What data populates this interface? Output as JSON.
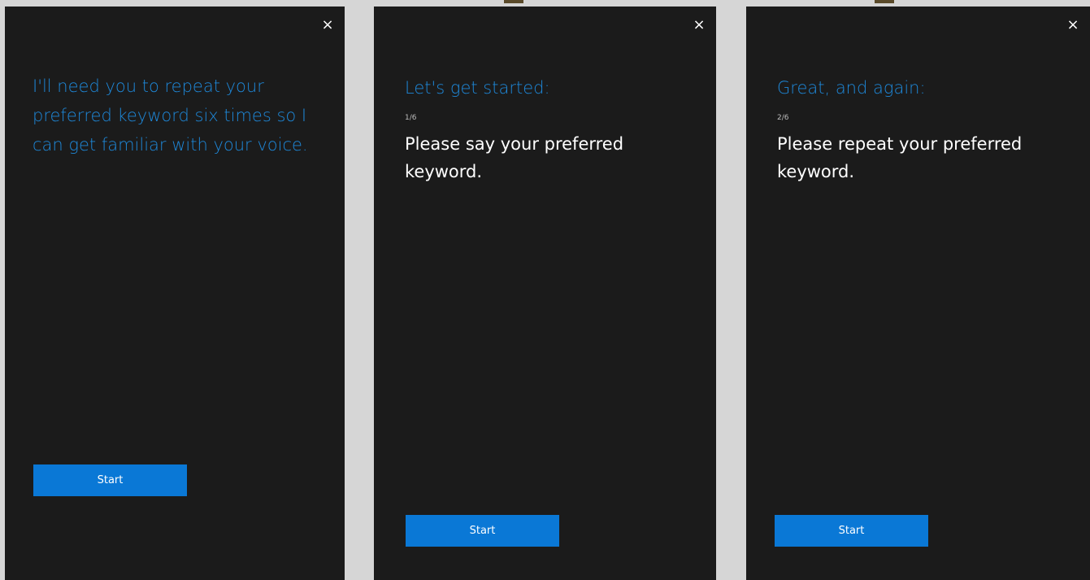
{
  "panels": [
    {
      "close_icon": "×",
      "heading": "I'll need you to repeat your preferred keyword six times so I can get familiar with your voice.",
      "start_label": "Start"
    },
    {
      "close_icon": "×",
      "heading": "Let's get started:",
      "counter": "1/6",
      "instruction": "Please say your preferred keyword.",
      "start_label": "Start"
    },
    {
      "close_icon": "×",
      "heading": "Great, and again:",
      "counter": "2/6",
      "instruction": "Please repeat your preferred keyword.",
      "start_label": "Start"
    }
  ],
  "colors": {
    "accent": "#0a78d6",
    "heading": "#1e88d9",
    "panel_bg": "#1b1b1b",
    "divider": "#d6d6d6"
  }
}
